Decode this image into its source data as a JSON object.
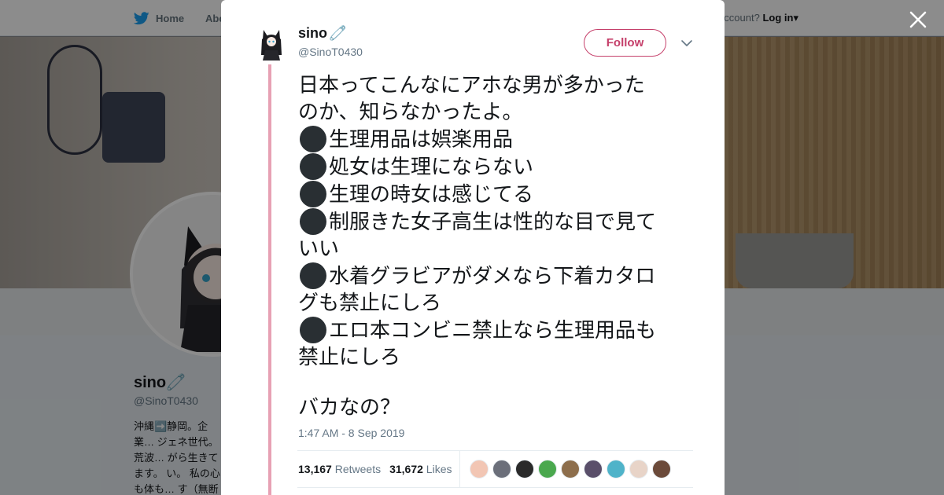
{
  "topbar": {
    "home_label": "Home",
    "about_label": "About",
    "account_prompt": "account?",
    "login_label": "Log in"
  },
  "profile": {
    "name": "sino",
    "handle": "@SinoT0430",
    "bio": "沖縄➡️静岡。企業… ジェネ世代。荒波… がら生きてます。 い。 私の心も体も… す（無断転載禁止…"
  },
  "tweet": {
    "author_name": "sino",
    "author_emoji": "🧷",
    "author_handle": "@SinoT0430",
    "follow_label": "Follow",
    "text_lines": {
      "l1": "日本ってこんなにアホな男が多かった",
      "l2": "のか、知らなかったよ。",
      "l3": "生理用品は娯楽用品",
      "l4": "処女は生理にならない",
      "l5": "生理の時女は感じてる",
      "l6": "制服きた女子高生は性的な目で見て",
      "l7": "いい",
      "l8": "水着グラビアがダメなら下着カタロ",
      "l9": "グも禁止にしろ",
      "l10": "エロ本コンビニ禁止なら生理用品も",
      "l11": "禁止にしろ",
      "l12": "バカなの？"
    },
    "timestamp": "1:47 AM - 8 Sep 2019",
    "retweets_count": "13,167",
    "retweets_label": "Retweets",
    "likes_count": "31,672",
    "likes_label": "Likes",
    "liker_colors": [
      "#f2c6b4",
      "#6b6f7a",
      "#2a2a2a",
      "#4aa84e",
      "#8d6e4c",
      "#5a4f6a",
      "#4fb3c9",
      "#e8d4c8",
      "#6b4a3a"
    ]
  },
  "colors": {
    "accent": "#c53f6a",
    "thread_line": "#e7a1b4",
    "twitter_blue": "#1da1f2"
  },
  "icons": [
    "twitter-bird-icon",
    "close-icon",
    "chevron-down-icon",
    "safety-pin-icon",
    "bullet-dot-icon"
  ]
}
